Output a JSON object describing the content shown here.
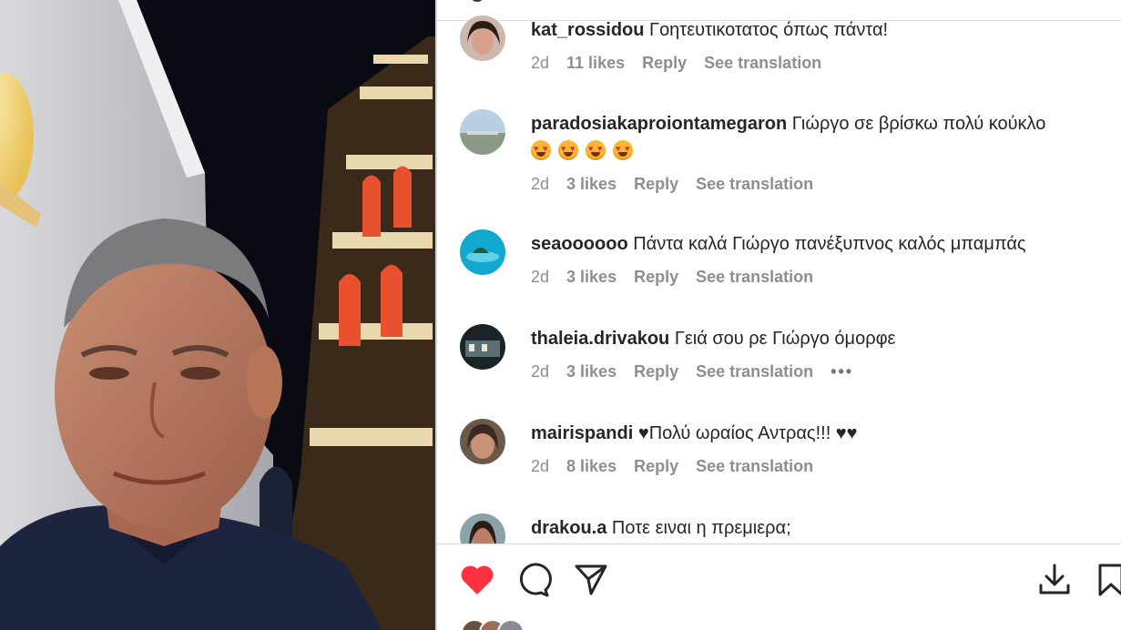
{
  "post": {
    "photo_alt": "Selfie of a man in front of an illuminated bell tower at night"
  },
  "comments": [
    {
      "username": "kat_rossidou",
      "text": "Γοητευτικοτατος όπως πάντα!",
      "time": "2d",
      "likes": "11 likes",
      "reply": "Reply",
      "translation": "See translation"
    },
    {
      "username": "paradosiakaproiontamegaron",
      "text": "Γιώργο σε βρίσκω πολύ κούκλο",
      "emojis": [
        "heart-eyes-emoji",
        "heart-eyes-emoji",
        "heart-eyes-emoji",
        "heart-eyes-emoji"
      ],
      "time": "2d",
      "likes": "3 likes",
      "reply": "Reply",
      "translation": "See translation"
    },
    {
      "username": "seaoooooo",
      "text": "Πάντα καλά Γιώργο πανέξυπνος καλός μπαμπάς",
      "time": "2d",
      "likes": "3 likes",
      "reply": "Reply",
      "translation": "See translation"
    },
    {
      "username": "thaleia.drivakou",
      "text": "Γειά σου ρε Γιώργο όμορφε",
      "time": "2d",
      "likes": "3 likes",
      "reply": "Reply",
      "translation": "See translation",
      "more": "•••"
    },
    {
      "username": "mairispandi",
      "text": "♥Πολύ ωραίος Αντρας!!! ♥♥",
      "time": "2d",
      "likes": "8 likes",
      "reply": "Reply",
      "translation": "See translation"
    },
    {
      "username": "drakou.a",
      "text": "Ποτε ειναι η πρεμιερα;"
    }
  ],
  "actions": {
    "like_icon": "heart-filled-icon",
    "comment_icon": "comment-icon",
    "share_icon": "send-icon",
    "download_icon": "download-icon",
    "save_icon": "bookmark-icon"
  },
  "colors": {
    "like_red": "#ff3040",
    "muted_text": "#8e8e8e",
    "text": "#262626"
  }
}
